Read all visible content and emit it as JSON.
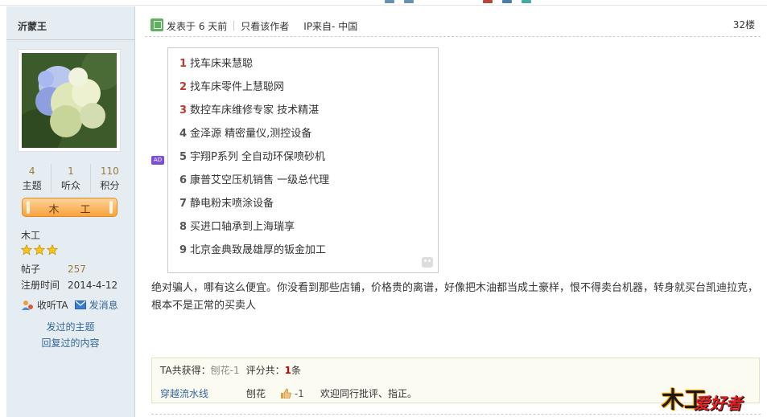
{
  "colors": {
    "accent_brown": "#9a7b3c",
    "link_blue": "#336699",
    "sidebar_bg": "#e5edf2",
    "rank_orange": "#f7a23d",
    "ad_number_red": "#c0392b"
  },
  "user": {
    "name": "沂蒙王",
    "stats": [
      {
        "value": "4",
        "label": "主题"
      },
      {
        "value": "1",
        "label": "听众"
      },
      {
        "value": "110",
        "label": "积分"
      }
    ],
    "rank_badge": "木工",
    "rank_title": "木工",
    "stars": 3,
    "posts_label": "帖子",
    "posts_value": "257",
    "register_label": "注册时间",
    "register_value": "2014-4-12",
    "follow_label": "收听TA",
    "message_label": "发消息",
    "threads_link": "发过的主题",
    "replies_link": "回复过的内容"
  },
  "post": {
    "posted": "发表于 6 天前",
    "author_only": "只看该作者",
    "ip": "IP来自- 中国",
    "floor": "32楼",
    "ad_badge": "AD",
    "ads": [
      {
        "num": "1",
        "text": "找车床来慧聪"
      },
      {
        "num": "2",
        "text": "找车床零件上慧聪网"
      },
      {
        "num": "3",
        "text": "数控车床维修专家 技术精湛"
      },
      {
        "num": "4",
        "text": "金泽源 精密量仪,测控设备"
      },
      {
        "num": "5",
        "text": "宇翔P系列 全自动环保喷砂机"
      },
      {
        "num": "6",
        "text": "康普艾空压机销售 一级总代理"
      },
      {
        "num": "7",
        "text": "静电粉末喷涂设备"
      },
      {
        "num": "8",
        "text": "买进口轴承到上海瑞享"
      },
      {
        "num": "9",
        "text": "北京金典致晟雄厚的钣金加工"
      }
    ],
    "content": "绝对骗人，哪有这么便宜。你没看到那些店铺，价格贵的离谱，好像把木油都当成土豪样，恨不得卖台机器，转身就买台凯迪拉克，根本不是正常的买卖人"
  },
  "rating": {
    "obtained_label": "TA共获得：",
    "obtained_value": "刨花-1",
    "total_label": "评分共：",
    "total_count": "1",
    "total_unit": "条",
    "rows": [
      {
        "user": "穿越流水线",
        "item": "刨花",
        "score": "-1",
        "comment": "欢迎同行批评、指正。"
      }
    ]
  },
  "logo": {
    "part1": "木工",
    "part2": "爱好者"
  }
}
